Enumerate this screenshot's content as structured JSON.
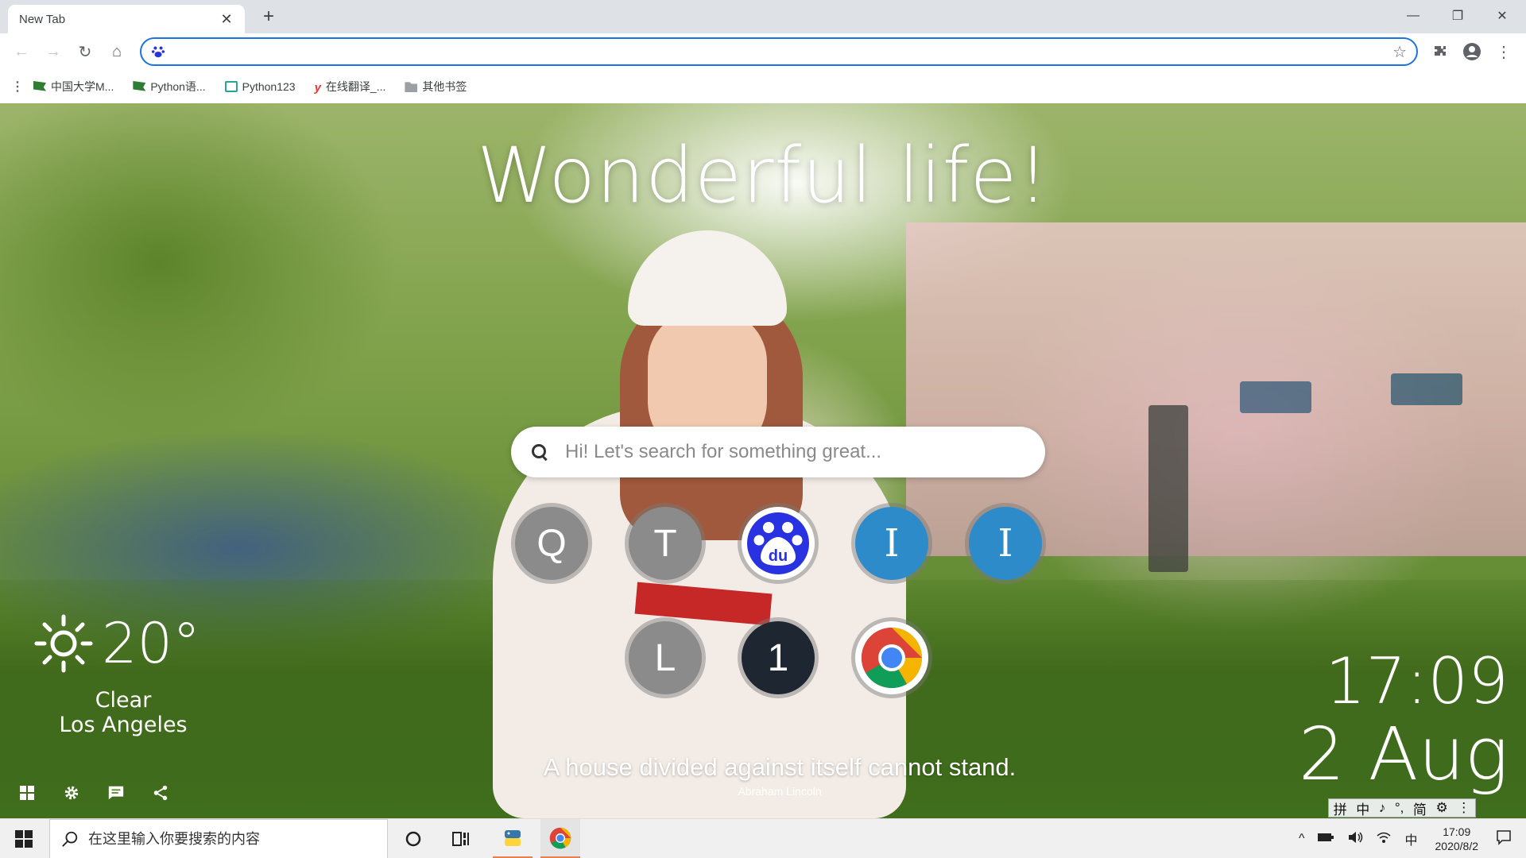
{
  "browser": {
    "tab": {
      "title": "New Tab",
      "close_glyph": "✕"
    },
    "new_tab_glyph": "+",
    "window_controls": {
      "minimize": "—",
      "restore": "❐",
      "close": "✕"
    },
    "toolbar": {
      "back_glyph": "←",
      "forward_glyph": "→",
      "reload_glyph": "↻",
      "home_glyph": "⌂",
      "omnibox_value": "",
      "star_glyph": "☆",
      "menu_glyph": "⋮"
    },
    "bookmarks": {
      "apps_glyph": "⋮",
      "items": [
        {
          "label": "中国大学M...",
          "icon": "flag-icon"
        },
        {
          "label": "Python语...",
          "icon": "flag-icon"
        },
        {
          "label": "Python123",
          "icon": "python123-icon"
        },
        {
          "label": "在线翻译_...",
          "icon": "youdao-icon"
        },
        {
          "label": "其他书签",
          "icon": "folder-icon"
        }
      ]
    }
  },
  "newtab": {
    "headline": "Wonderful life!",
    "search": {
      "placeholder": "Hi! Let's search for something great..."
    },
    "shortcuts_row1": [
      {
        "label": "Q",
        "style": "gray"
      },
      {
        "label": "T",
        "style": "gray"
      },
      {
        "label": "",
        "style": "baidu"
      },
      {
        "label": "I",
        "style": "blue"
      },
      {
        "label": "I",
        "style": "blue"
      }
    ],
    "shortcuts_row2": [
      {
        "label": "L",
        "style": "gray"
      },
      {
        "label": "1",
        "style": "dark"
      },
      {
        "label": "",
        "style": "chrome"
      }
    ],
    "weather": {
      "temperature": "20°",
      "condition": "Clear",
      "city": "Los Angeles",
      "icon": "sun-icon"
    },
    "clock": {
      "time": "17:09",
      "date": "2 Aug"
    },
    "quote": {
      "text": "A house divided against itself cannot stand.",
      "author": "Abraham Lincoln"
    },
    "tools": [
      "apps-grid-icon",
      "gear-icon",
      "comment-icon",
      "share-icon"
    ]
  },
  "ime": {
    "items": [
      "拼",
      "中",
      "♪",
      "°,",
      "简",
      "⚙",
      "⋮"
    ]
  },
  "taskbar": {
    "search_placeholder": "在这里输入你要搜索的内容",
    "tray": {
      "chevron": "^",
      "ime_label": "中",
      "time": "17:09",
      "date": "2020/8/2"
    }
  },
  "colors": {
    "omnibox_border": "#1a73e8",
    "tile_gray": "#8b8b8b",
    "tile_blue": "#2e8bc9",
    "tile_dark": "#1e2631",
    "taskbar_bg": "#f0f0f0"
  }
}
